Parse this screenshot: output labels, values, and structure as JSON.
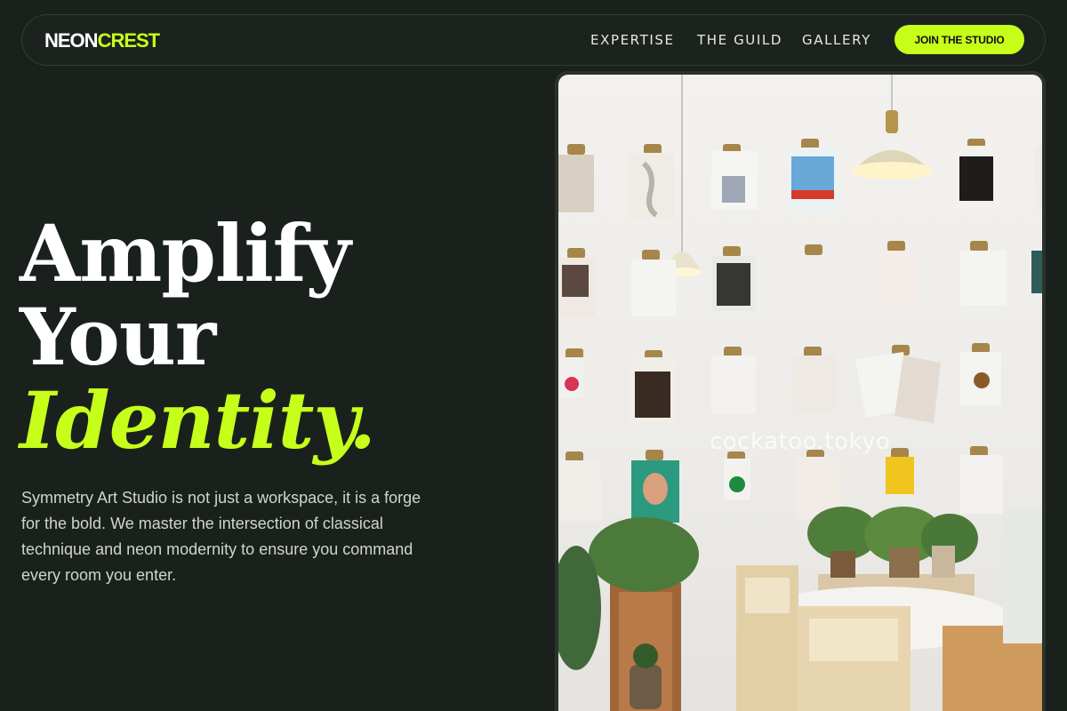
{
  "brand": {
    "part1": "NEON",
    "part2": "CREST"
  },
  "nav": {
    "links": [
      "EXPERTISE",
      "THE GUILD",
      "GALLERY"
    ],
    "cta": "JOIN THE STUDIO"
  },
  "hero": {
    "line1": "Amplify",
    "line2": "Your",
    "line3": "Identity.",
    "description": "Symmetry Art Studio is not just a workspace, it is a forge for the bold. We master the intersection of classical technique and neon modernity to ensure you command every room you enter."
  },
  "image": {
    "watermark": "cockatoo.tokyo"
  },
  "colors": {
    "accent": "#c6ff1a",
    "background": "#1a211c",
    "text": "#ffffff"
  }
}
